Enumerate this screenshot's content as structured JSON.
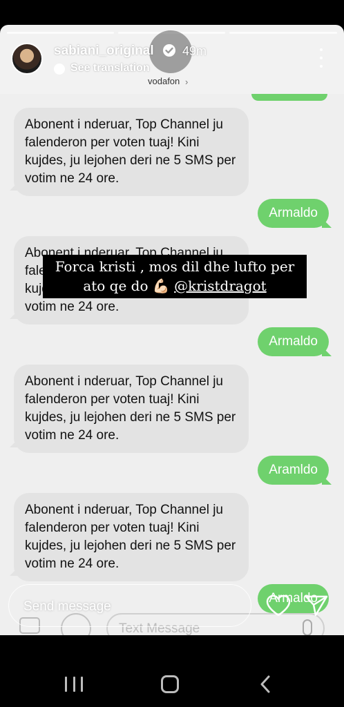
{
  "header": {
    "username": "sabiani_original",
    "time_ago": "49m",
    "see_translation": "See translation"
  },
  "sms_thread": {
    "carrier": "vodafon",
    "carrier_chevron": "›",
    "messages": [
      {
        "direction": "in",
        "text": "Abonent i nderuar, Top Channel ju falenderon per voten tuaj! Kini kujdes, ju lejohen deri ne 5 SMS per votim ne 24 ore."
      },
      {
        "direction": "out",
        "text": "Armaldo"
      },
      {
        "direction": "in",
        "text": "Abonent i nderuar, Top Channel ju falenderon per voten tuaj! Kini kujdes, ju lejohen deri ne 5 SMS per votim ne 24 ore."
      },
      {
        "direction": "out",
        "text": "Armaldo"
      },
      {
        "direction": "in",
        "text": "Abonent i nderuar, Top Channel ju falenderon per voten tuaj! Kini kujdes, ju lejohen deri ne 5 SMS per votim ne 24 ore."
      },
      {
        "direction": "out",
        "text": "Aramldo"
      },
      {
        "direction": "in",
        "text": "Abonent i nderuar, Top Channel ju falenderon per voten tuaj! Kini kujdes, ju lejohen deri ne 5 SMS per votim ne 24 ore."
      },
      {
        "direction": "out",
        "text": "Armaldo"
      }
    ],
    "input_placeholder": "Text Message"
  },
  "caption": {
    "text": "Forca kristi , mos dil dhe lufto per ato qe do 💪🏻",
    "mention": "@kristdragot"
  },
  "reply": {
    "placeholder": "Send message"
  },
  "colors": {
    "outgoing_bubble": "#6fd16d",
    "incoming_bubble": "#e3e3e3",
    "caption_bg": "#000000"
  },
  "icons": [
    "verified-icon",
    "more-icon",
    "translate-icon",
    "camera-icon",
    "apps-icon",
    "mic-icon",
    "heart-icon",
    "send-icon",
    "nav-recents-icon",
    "nav-home-icon",
    "nav-back-icon"
  ]
}
